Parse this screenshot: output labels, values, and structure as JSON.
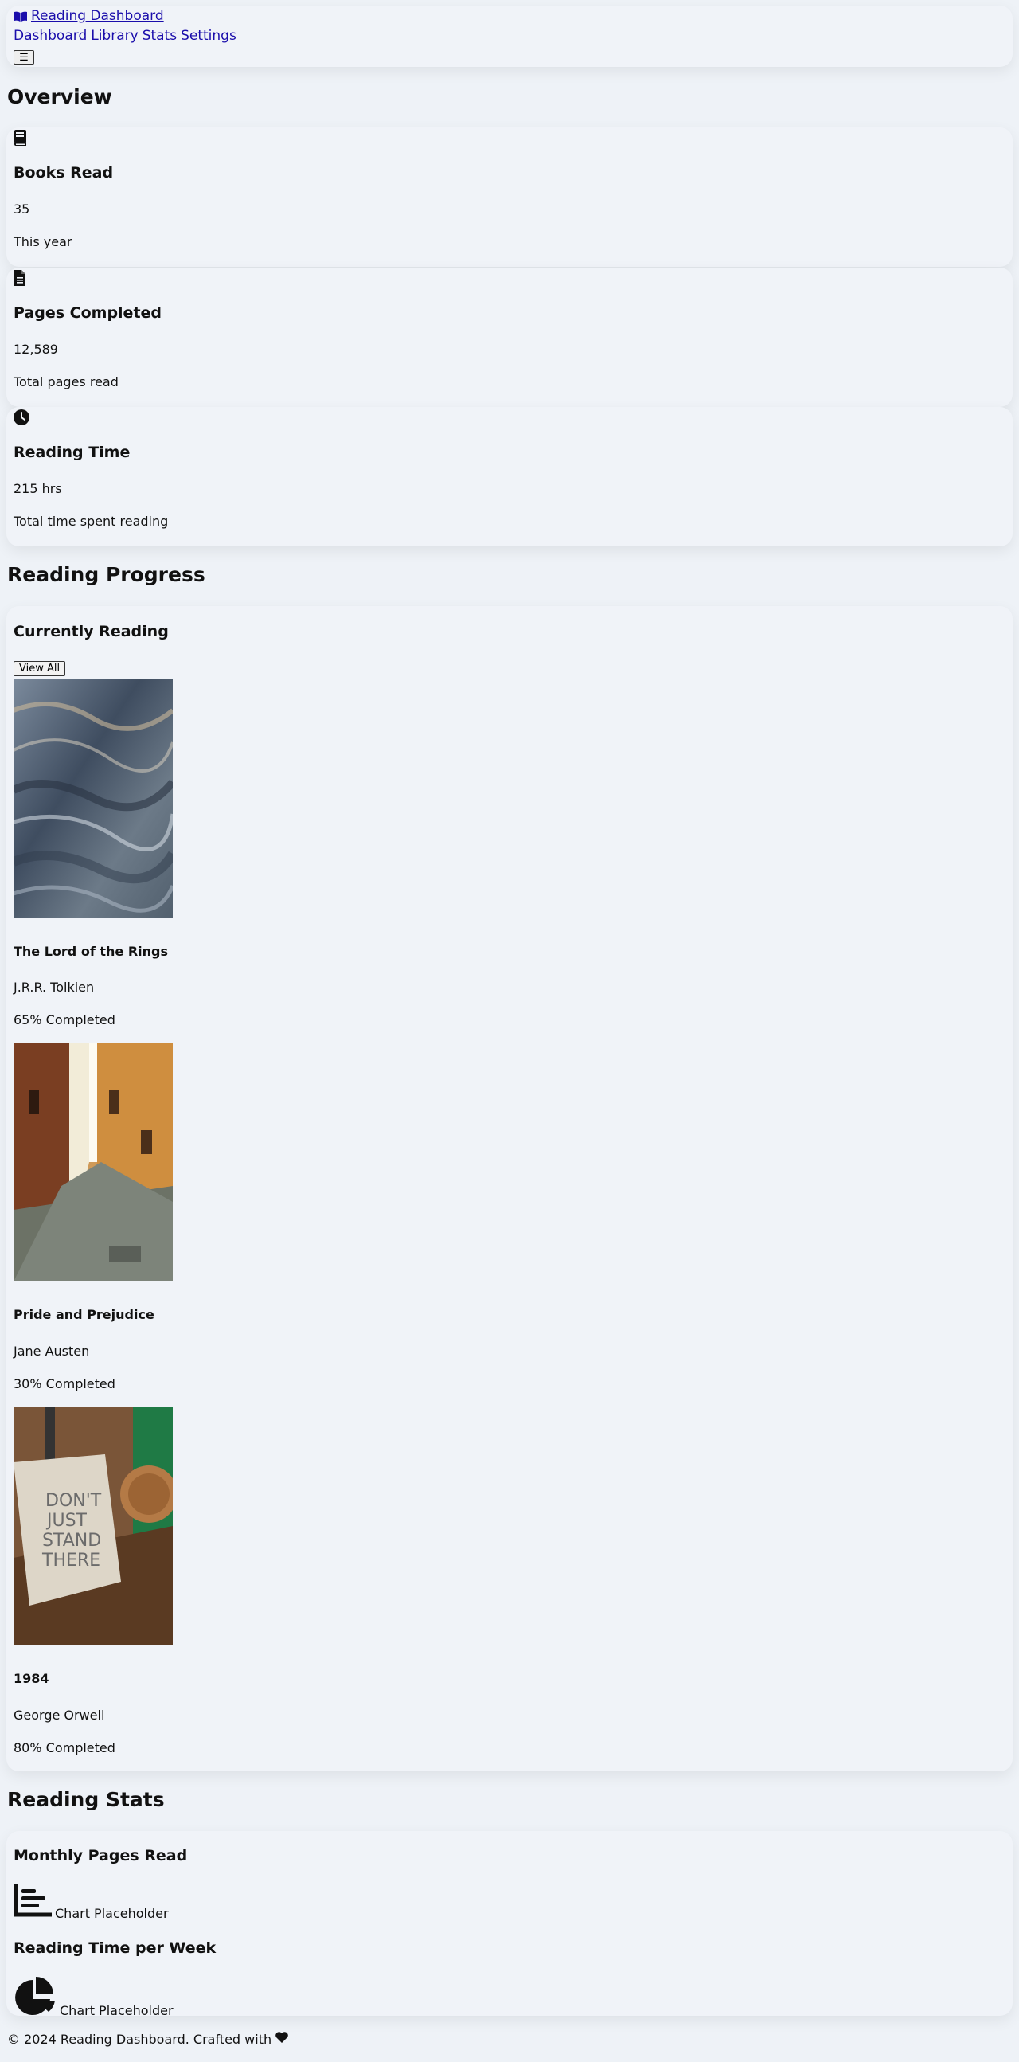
{
  "header": {
    "brand": "Reading Dashboard",
    "brand_icon": "open-book-icon",
    "nav": [
      "Dashboard",
      "Library",
      "Stats",
      "Settings"
    ],
    "menu_icon": "hamburger-icon",
    "menu_glyph": "☰"
  },
  "overview": {
    "title": "Overview",
    "cards": [
      {
        "icon": "book-icon",
        "title": "Books Read",
        "value": "35",
        "caption": "This year"
      },
      {
        "icon": "document-icon",
        "title": "Pages Completed",
        "value": "12,589",
        "caption": "Total pages read"
      },
      {
        "icon": "clock-icon",
        "title": "Reading Time",
        "value": "215 hrs",
        "caption": "Total time spent reading"
      }
    ]
  },
  "progress": {
    "title": "Reading Progress",
    "subtitle": "Currently Reading",
    "view_all": "View All",
    "books": [
      {
        "title": "The Lord of the Rings",
        "author": "J.R.R. Tolkien",
        "progress": "65% Completed",
        "percent": 65
      },
      {
        "title": "Pride and Prejudice",
        "author": "Jane Austen",
        "progress": "30% Completed",
        "percent": 30
      },
      {
        "title": "1984",
        "author": "George Orwell",
        "progress": "80% Completed",
        "percent": 80
      }
    ],
    "cover_book3_text": [
      "DON'T",
      "JUST",
      "STAND",
      "THERE"
    ]
  },
  "stats": {
    "title": "Reading Stats",
    "charts": [
      {
        "title": "Monthly Pages Read",
        "icon": "bar-chart-icon",
        "placeholder": "Chart Placeholder"
      },
      {
        "title": "Reading Time per Week",
        "icon": "pie-chart-icon",
        "placeholder": "Chart Placeholder"
      }
    ]
  },
  "footer": {
    "text": "© 2024 Reading Dashboard. Crafted with",
    "icon": "heart-icon"
  }
}
